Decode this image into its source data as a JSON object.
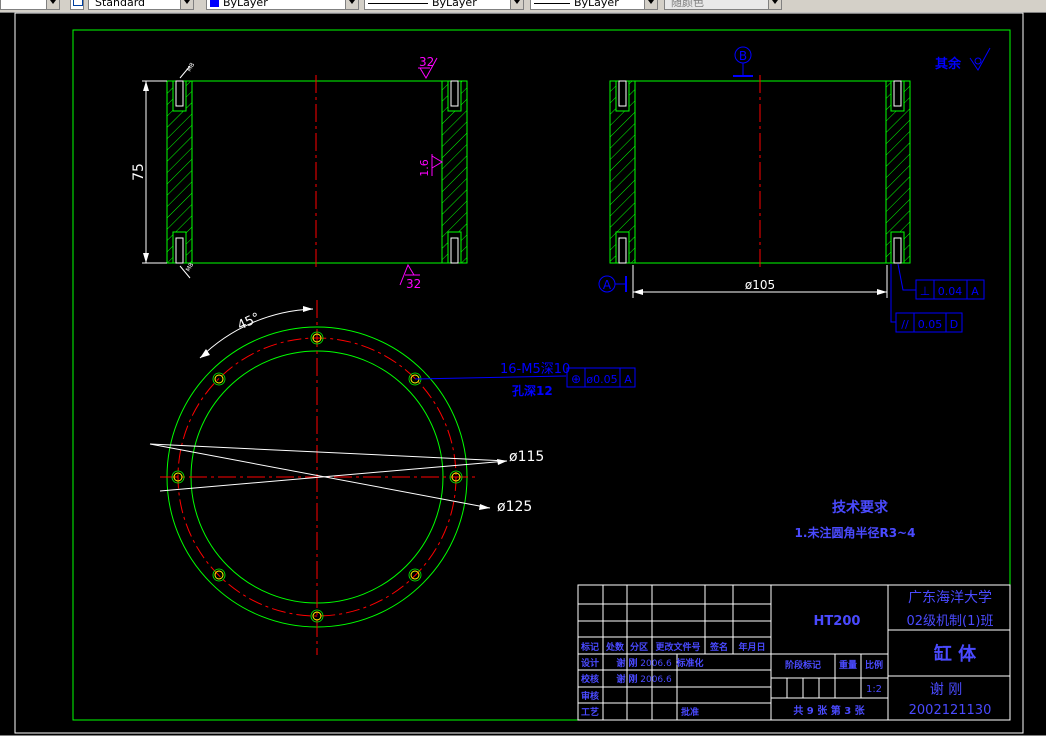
{
  "toolbar": {
    "textstyle_value": "Standard",
    "color_value": "ByLayer",
    "linetype_value": "ByLayer",
    "lineweight_value": "ByLayer",
    "plotstyle_value": "随颜色"
  },
  "drawing": {
    "dim_height": "75",
    "dim_small": "M8",
    "roughness_top": "32",
    "roughness_side": "1.6",
    "roughness_bottom": "32",
    "datum_b": "B",
    "datum_a": "A",
    "rest_roughness": "其余",
    "dim_diameter_105": "ø105",
    "tol_perp_symbol": "⊥",
    "tol_perp_value": "0.04",
    "tol_perp_datum": "A",
    "tol_par_symbol": "//",
    "tol_par_value": "0.05",
    "tol_par_datum": "D",
    "angle_label": "45°",
    "hole_callout_line1": "16-M5深10",
    "hole_callout_line2": "孔深12",
    "tol_pos_symbol": "⊕",
    "tol_pos_value": "ø0.05",
    "tol_pos_datum": "A",
    "dim_diameter_115": "ø115",
    "dim_diameter_125": "ø125",
    "tech_req_title": "技术要求",
    "tech_req_item1": "1.未注圆角半径R3~4"
  },
  "title_block": {
    "material": "HT200",
    "school": "广东海洋大学",
    "class": "02级机制(1)班",
    "part_name": "缸    体",
    "designer_name": "谢  刚",
    "student_id": "2002121130",
    "h_mark": "标记",
    "h_count": "处数",
    "h_zone": "分区",
    "h_change_doc": "更改文件号",
    "h_sign": "签名",
    "h_date": "年月日",
    "r_design": "设计",
    "r_design_name": "谢  刚",
    "r_design_date": "2006.6",
    "r_std": "标准化",
    "r_check": "校核",
    "r_check_name": "谢  刚",
    "r_check_date": "2006.6",
    "r_approve": "批准",
    "r_review": "审核",
    "r_process": "工艺",
    "stage_label": "阶段标记",
    "weight_label": "重量",
    "scale_label": "比例",
    "scale_value": "1:2",
    "sheets_label": "共 9 张    第 3 张"
  },
  "colors": {
    "border": "#00ff00",
    "centerline": "#ff0000",
    "dimension": "#ffffff",
    "annotation_blue": "#0000ff",
    "roughness_magenta": "#ff00ff",
    "title_text": "#4a4aff"
  }
}
